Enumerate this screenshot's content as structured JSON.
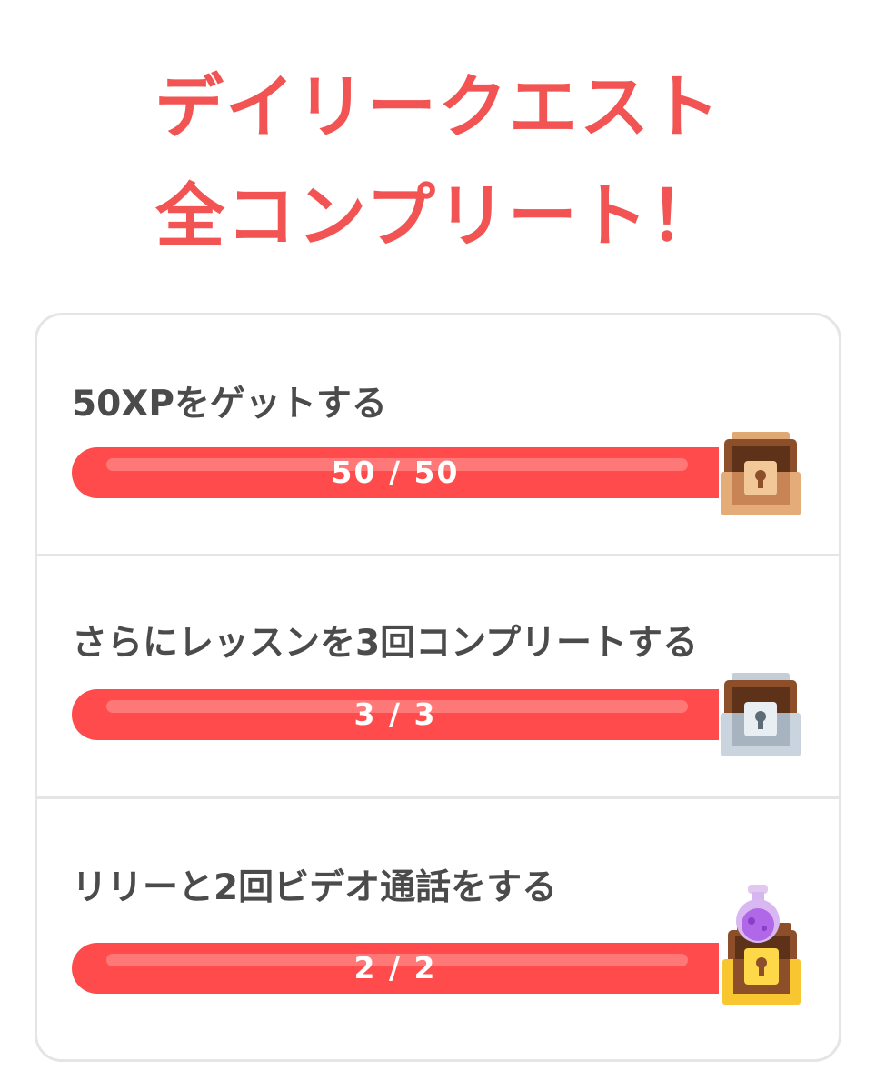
{
  "header": {
    "line1": "デイリークエスト",
    "line2": "全コンプリート！"
  },
  "quests": [
    {
      "label": "50XPをゲットする",
      "progress_text": "50 / 50",
      "current": 50,
      "total": 50,
      "reward_icon": "bronze-chest-icon"
    },
    {
      "label": "さらにレッスンを3回コンプリートする",
      "progress_text": "3 / 3",
      "current": 3,
      "total": 3,
      "reward_icon": "silver-chest-icon"
    },
    {
      "label": "リリーと2回ビデオ通話をする",
      "progress_text": "2 / 2",
      "current": 2,
      "total": 2,
      "reward_icon": "gold-chest-potion-icon"
    }
  ],
  "colors": {
    "accent": "#ff4b4b",
    "title": "#f25353",
    "text": "#4b4b4b",
    "border": "#e5e5e5"
  }
}
